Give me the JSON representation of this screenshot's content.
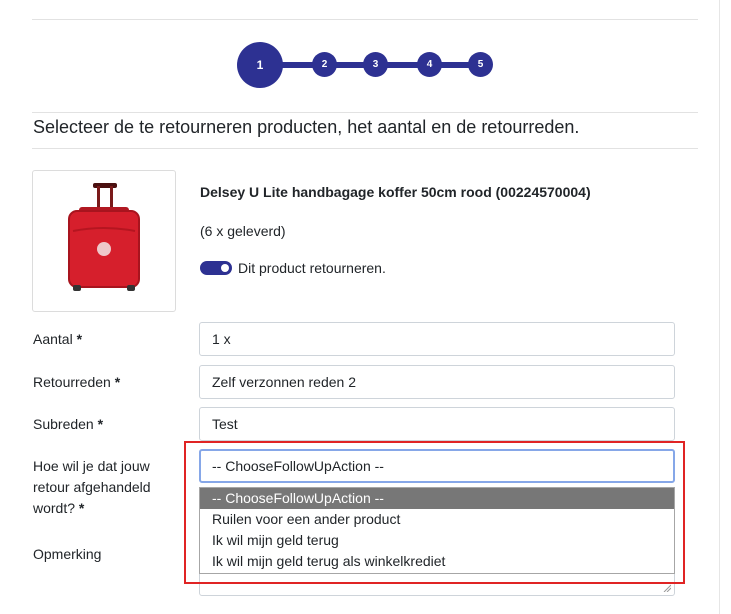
{
  "stepper": {
    "steps": [
      "1",
      "2",
      "3",
      "4",
      "5"
    ],
    "active": "1"
  },
  "section_title": "Selecteer de te retourneren producten, het aantal en de retourreden.",
  "product": {
    "name": "Delsey U Lite handbagage koffer 50cm rood (00224570004)",
    "delivered": "(6 x geleverd)",
    "return_toggle_label": "Dit product retourneren.",
    "return_toggle_on": true
  },
  "form": {
    "quantity": {
      "label": "Aantal",
      "required": "*",
      "value": "1 x"
    },
    "reason": {
      "label": "Retourreden",
      "required": "*",
      "value": "Zelf verzonnen reden 2"
    },
    "subreason": {
      "label": "Subreden",
      "required": "*",
      "value": "Test"
    },
    "followup": {
      "label_line1": "Hoe wil je dat jouw",
      "label_line2": "retour afgehandeld",
      "label_line3": "wordt?",
      "required": "*",
      "value": "-- ChooseFollowUpAction --",
      "options": [
        "-- ChooseFollowUpAction --",
        "Ruilen voor een ander product",
        "Ik wil mijn geld terug",
        "Ik wil mijn geld terug als winkelkrediet"
      ],
      "selected_index": 0
    },
    "remark": {
      "label": "Opmerking",
      "value": ""
    }
  },
  "colors": {
    "primary": "#2d3192",
    "highlight": "#e02424",
    "option_selected": "#777777"
  }
}
